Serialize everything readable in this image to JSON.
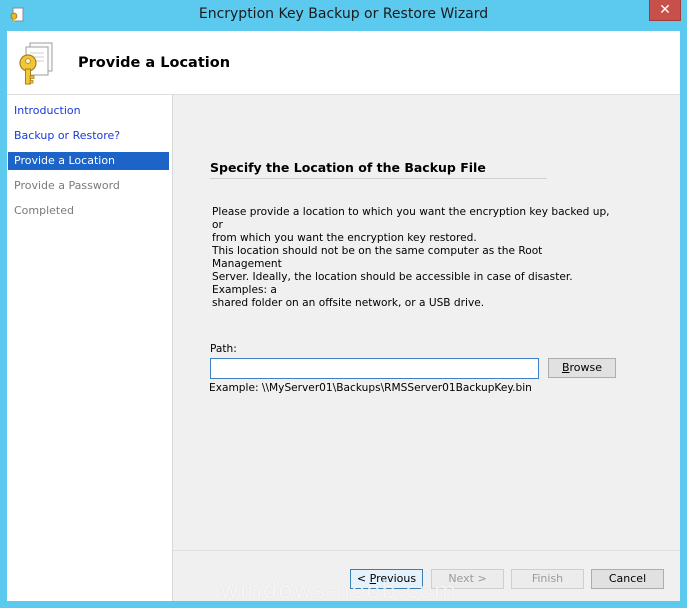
{
  "window": {
    "title": "Encryption Key Backup or Restore Wizard",
    "close_glyph": "✕",
    "accent_color": "#5cc9ee"
  },
  "header": {
    "title": "Provide a Location",
    "icon": "document-key-icon"
  },
  "nav": {
    "items": [
      {
        "label": "Introduction",
        "state": "link"
      },
      {
        "label": "Backup or Restore?",
        "state": "link"
      },
      {
        "label": "Provide a Location",
        "state": "active"
      },
      {
        "label": "Provide a Password",
        "state": "disabled"
      },
      {
        "label": "Completed",
        "state": "disabled"
      }
    ]
  },
  "main": {
    "section_title": "Specify the Location of the Backup File",
    "paragraph1_line1": "Please provide a location to which you want the encryption key backed up, or",
    "paragraph1_line2": "from which you want the encryption key restored.",
    "paragraph2_line1": "This location should not be on the same computer as the Root Management",
    "paragraph2_line2": "Server. Ideally, the location should be accessible in case of disaster. Examples: a",
    "paragraph2_line3": "shared folder on an offsite network, or a USB drive.",
    "path_label": "Path:",
    "path_value": "",
    "browse_label_prefix": "",
    "browse_label_key": "B",
    "browse_label_rest": "rowse",
    "example": "Example: \\\\MyServer01\\Backups\\RMSServer01BackupKey.bin"
  },
  "footer": {
    "previous_prefix": "< ",
    "previous_key": "P",
    "previous_rest": "revious",
    "next_label": "Next >",
    "finish_label": "Finish",
    "cancel_label": "Cancel"
  },
  "watermark": "windows-noob.com"
}
